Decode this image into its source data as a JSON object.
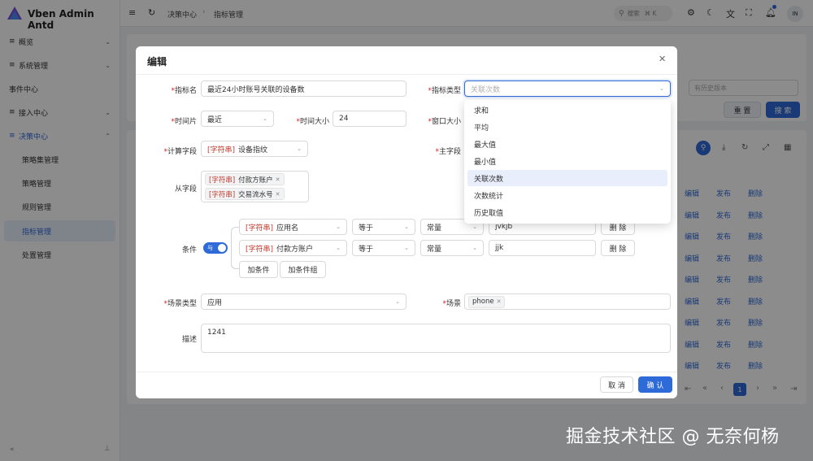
{
  "sidebar": {
    "app_title": "Vben Admin Antd",
    "items": [
      {
        "label": "概览",
        "icon": "menu-icon"
      },
      {
        "label": "系统管理",
        "icon": "menu-icon"
      },
      {
        "label": "事件中心"
      },
      {
        "label": "接入中心",
        "icon": "menu-icon"
      },
      {
        "label": "决策中心",
        "icon": "menu-icon"
      }
    ],
    "sub_items": [
      {
        "label": "策略集管理"
      },
      {
        "label": "策略管理"
      },
      {
        "label": "规则管理"
      },
      {
        "label": "指标管理"
      },
      {
        "label": "处置管理"
      }
    ],
    "collapse_glyph": "«",
    "pin_glyph": "⊥"
  },
  "header": {
    "breadcrumb": [
      "决策中心",
      "指标管理"
    ],
    "search_placeholder": "搜索",
    "search_shortcut": "⌘ K",
    "avatar_text": "IN"
  },
  "background": {
    "history_placeholder": "有历史版本",
    "reset_label": "重 置",
    "search_label": "搜 索",
    "row_actions": [
      "编辑",
      "发布",
      "删除"
    ],
    "row_count": 9,
    "current_page": "1"
  },
  "modal": {
    "title": "编辑",
    "metric_name_label": "指标名",
    "metric_name_value": "最近24小时账号关联的设备数",
    "metric_type_label": "指标类型",
    "metric_type_placeholder": "关联次数",
    "time_slice_label": "时间片",
    "time_slice_value": "最近",
    "time_size_label": "时间大小",
    "time_size_value": "24",
    "window_size_label": "窗口大小",
    "calc_field_label": "计算字段",
    "calc_field_type": "[字符串]",
    "calc_field_value": "设备指纹",
    "main_field_label": "主字段",
    "sub_field_label": "从字段",
    "sub_field_tags": [
      {
        "type": "[字符串]",
        "value": "付款方账户"
      },
      {
        "type": "[字符串]",
        "value": "交易流水号"
      }
    ],
    "condition_label": "条件",
    "condition_toggle": "与",
    "conditions": [
      {
        "field_type": "[字符串]",
        "field": "应用名",
        "op": "等于",
        "kind": "常量",
        "value": "jvkjb",
        "delete": "删 除"
      },
      {
        "field_type": "[字符串]",
        "field": "付款方账户",
        "op": "等于",
        "kind": "常量",
        "value": "jjk",
        "delete": "删 除"
      }
    ],
    "add_condition": "加条件",
    "add_condition_group": "加条件组",
    "scene_type_label": "场景类型",
    "scene_type_value": "应用",
    "scene_label": "场景",
    "scene_tag": "phone",
    "desc_label": "描述",
    "desc_value": "1241",
    "cancel_label": "取 消",
    "ok_label": "确 认"
  },
  "dropdown": {
    "options": [
      "求和",
      "平均",
      "最大值",
      "最小值",
      "关联次数",
      "次数统计",
      "历史取值"
    ],
    "highlighted": "关联次数"
  },
  "watermark": "掘金技术社区 @ 无奈何杨",
  "colors": {
    "primary": "#2f6bd8",
    "required": "#e02020",
    "type_tag": "#c0392b"
  }
}
